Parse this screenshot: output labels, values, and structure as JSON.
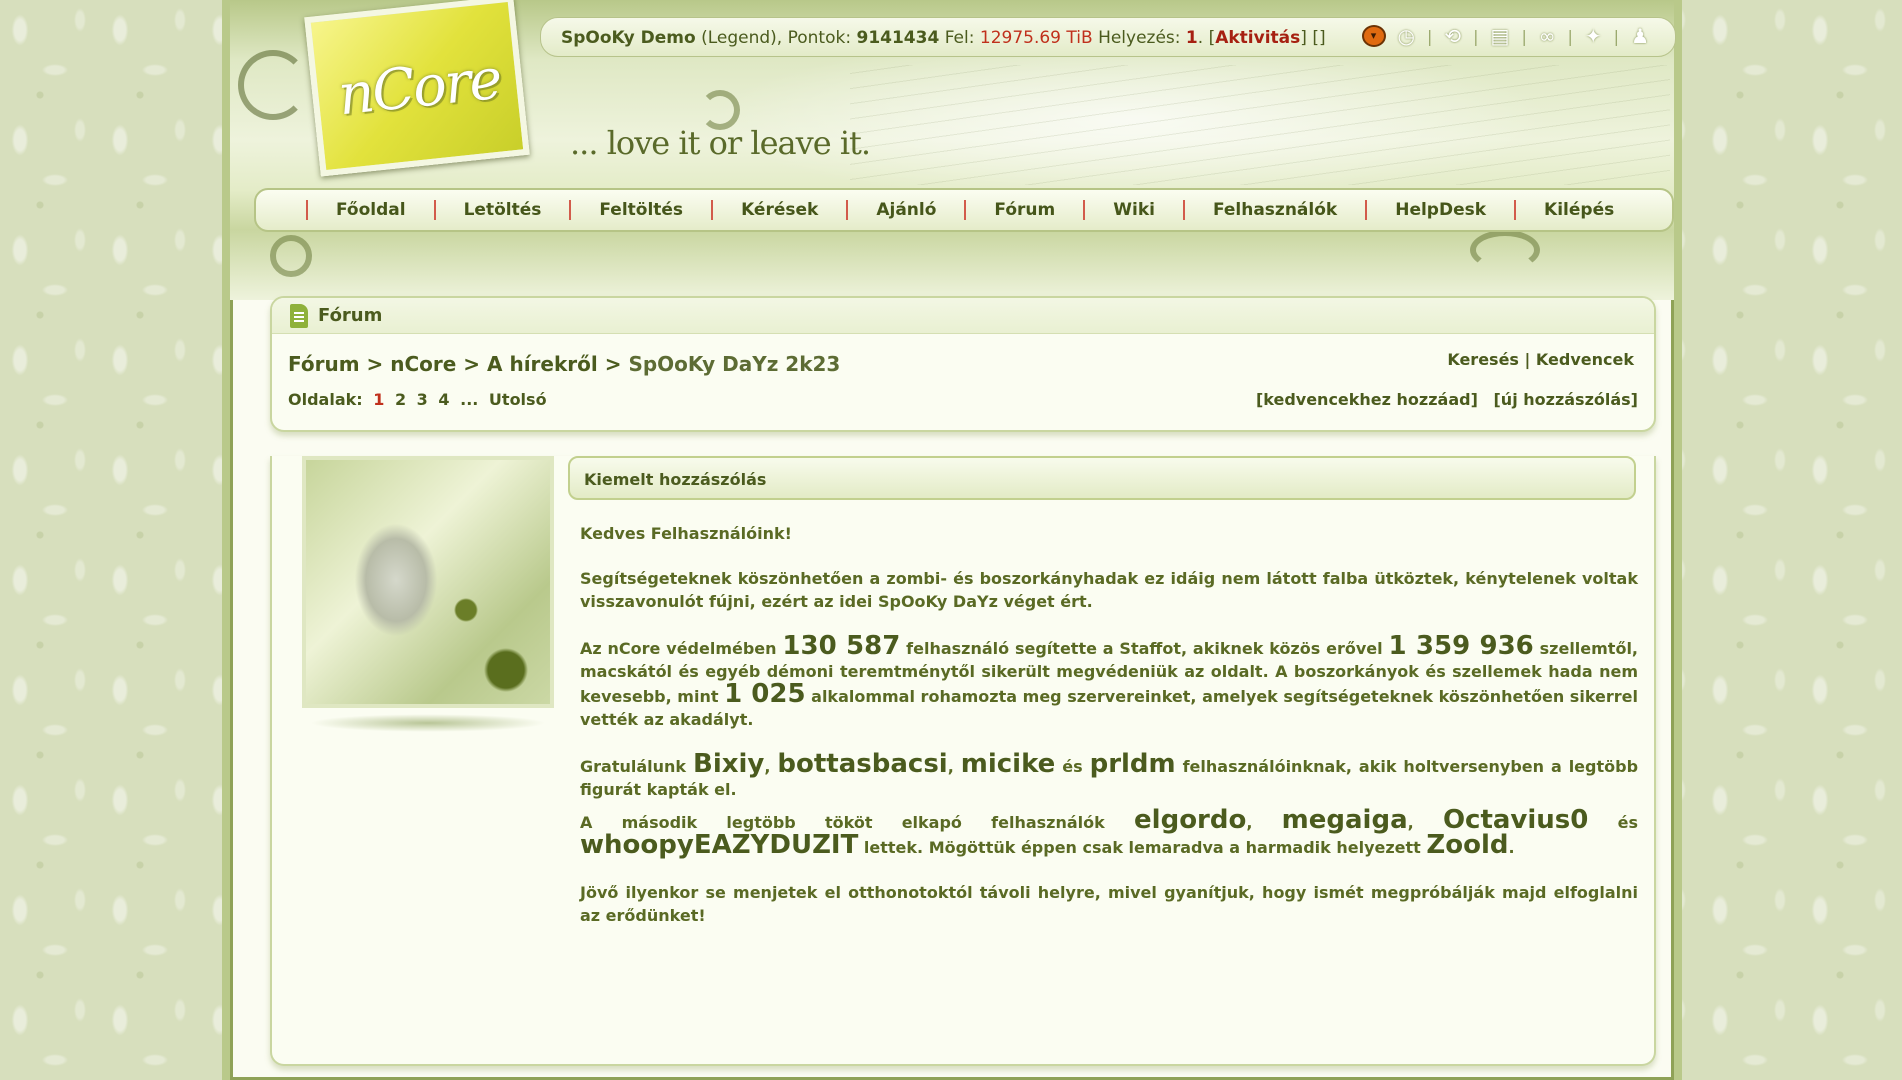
{
  "brand": {
    "logo_text": "nCore",
    "tagline": "... love it or leave it."
  },
  "userbar": {
    "username": "SpOoKy Demo",
    "rank": "(Legend)",
    "points_label": "Pontok:",
    "points": "9141434",
    "upload_label": "Fel:",
    "upload": "12975.69 TiB",
    "rank_label": "Helyezés:",
    "position": "1",
    "activity_link": "Aktivitás",
    "brackets": "[]",
    "icons": [
      "pumpkin-icon",
      "clock-icon",
      "refresh-icon",
      "document-icon",
      "link-icon",
      "settings-icon",
      "user-icon"
    ]
  },
  "nav": [
    "Főoldal",
    "Letöltés",
    "Feltöltés",
    "Kérések",
    "Ajánló",
    "Fórum",
    "Wiki",
    "Felhasználók",
    "HelpDesk",
    "Kilépés"
  ],
  "forum": {
    "section_title": "Fórum",
    "breadcrumb": [
      "Fórum",
      "nCore",
      "A hírekről",
      "SpOoKy DaYz 2k23"
    ],
    "pages_label": "Oldalak:",
    "pages": [
      "1",
      "2",
      "3",
      "4",
      "...",
      "Utolsó"
    ],
    "current_page": "1",
    "search_link": "Keresés",
    "favorites_link": "Kedvencek",
    "add_favorite": "[kedvencekhez hozzáad]",
    "new_post": "[új hozzászólás]"
  },
  "post": {
    "title": "Kiemelt hozzászólás",
    "greeting": "Kedves Felhasználóink!",
    "p1": "Segítségeteknek köszönhetően a zombi- és boszorkányhadak ez idáig nem látott falba ütköztek, kénytelenek voltak visszavonulót fújni, ezért az idei SpOoKy DaYz véget ért.",
    "p2_a": "Az nCore védelmében ",
    "p2_n1": "130 587",
    "p2_b": " felhasználó segítette a Staffot, akiknek közös erővel ",
    "p2_n2": "1 359 936",
    "p2_c": " szellemtől, macskától és egyéb démoni teremtménytől sikerült megvédeniük az oldalt. A boszorkányok és szellemek hada nem kevesebb, mint ",
    "p2_n3": "1 025",
    "p2_d": " alkalommal rohamozta meg szervereinket, amelyek segítségeteknek köszönhetően sikerrel vették az akadályt.",
    "p3_a": "Gratulálunk ",
    "winners": [
      "Bixiy",
      "bottasbacsi",
      "micike",
      "prldm"
    ],
    "p3_sep1": ", ",
    "p3_and": " és ",
    "p3_b": " felhasználóinknak, akik holtversenyben a legtöbb figurát kapták el.",
    "p4_a": "A második legtöbb tököt elkapó felhasználók ",
    "second": [
      "elgordo",
      "megaiga",
      "Octavius0",
      "whoopyEAZYDUZIT"
    ],
    "p4_b": " lettek. Mögöttük éppen csak lemaradva a harmadik helyezett ",
    "third": "Zoold",
    "p4_c": ".",
    "p5": "Jövő ilyenkor se menjetek el otthonotoktól távoli helyre, mivel gyanítjuk, hogy ismét megpróbálják majd elfoglalni az erődünket!"
  },
  "colors": {
    "accent_green": "#4b5b1e",
    "highlight_red": "#c0301c",
    "nav_separator": "#d25b4b"
  }
}
